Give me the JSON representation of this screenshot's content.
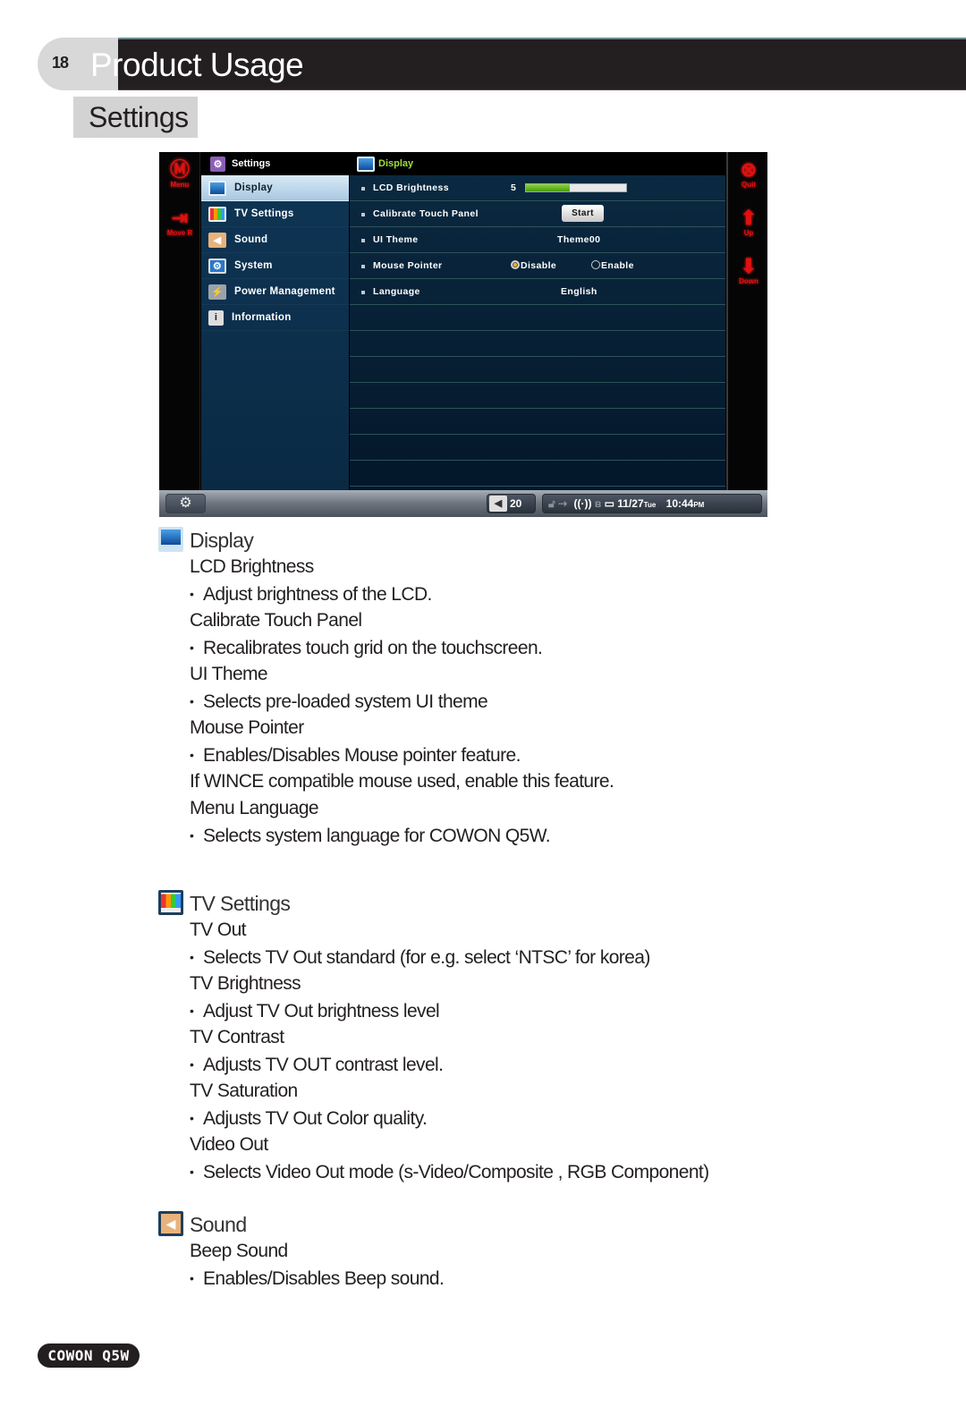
{
  "header": {
    "page_number": "18",
    "title": "Product Usage",
    "section": "Settings"
  },
  "device": {
    "left_buttons": [
      {
        "icon": "menu-circle-m-icon",
        "glyph": "Ⓜ",
        "label": "Menu"
      },
      {
        "icon": "move-right-icon",
        "glyph": "⇥",
        "label": "Move R"
      }
    ],
    "right_buttons": [
      {
        "icon": "quit-circle-x-icon",
        "glyph": "⊗",
        "label": "Quit"
      },
      {
        "icon": "arrow-up-icon",
        "glyph": "⬆",
        "label": "Up"
      },
      {
        "icon": "arrow-down-icon",
        "glyph": "⬇",
        "label": "Down"
      }
    ],
    "menu": {
      "title": "Settings",
      "items": [
        {
          "label": "Display",
          "icon": "display-monitor-icon",
          "active": true
        },
        {
          "label": "TV Settings",
          "icon": "tv-color-bars-icon"
        },
        {
          "label": "Sound",
          "icon": "speaker-icon"
        },
        {
          "label": "System",
          "icon": "system-gear-icon"
        },
        {
          "label": "Power Management",
          "icon": "power-lightning-icon"
        },
        {
          "label": "Information",
          "icon": "info-icon"
        }
      ]
    },
    "panel": {
      "title": "Display",
      "rows": [
        {
          "label": "LCD Brightness",
          "value": "5",
          "bar_fraction": 0.44
        },
        {
          "label": "Calibrate Touch Panel",
          "button": "Start"
        },
        {
          "label": "UI Theme",
          "value": "Theme00"
        },
        {
          "label": "Mouse Pointer",
          "options": [
            "Disable",
            "Enable"
          ],
          "selected": "Disable"
        },
        {
          "label": "Language",
          "value": "English"
        }
      ]
    },
    "status": {
      "volume": "20",
      "date": "11/27",
      "weekday": "Tue",
      "time": "10:44",
      "ampm": "PM"
    }
  },
  "sections": [
    {
      "title": "Display",
      "lines": [
        {
          "type": "sub",
          "text": "LCD Brightness"
        },
        {
          "type": "bullet",
          "text": "Adjust brightness of the LCD."
        },
        {
          "type": "sub",
          "text": "Calibrate Touch Panel"
        },
        {
          "type": "bullet",
          "text": "Recalibrates touch grid on the touchscreen."
        },
        {
          "type": "sub",
          "text": "UI Theme"
        },
        {
          "type": "bullet",
          "text": "Selects pre-loaded system UI theme"
        },
        {
          "type": "sub",
          "text": "Mouse Pointer"
        },
        {
          "type": "bullet",
          "text": "Enables/Disables Mouse pointer feature."
        },
        {
          "type": "sub",
          "text": "If WINCE compatible mouse used, enable this feature."
        },
        {
          "type": "sub",
          "text": "Menu Language"
        },
        {
          "type": "bullet",
          "text": "Selects system language for COWON Q5W."
        }
      ]
    },
    {
      "title": "TV Settings",
      "lines": [
        {
          "type": "sub",
          "text": "TV Out"
        },
        {
          "type": "bullet",
          "text": "Selects TV Out standard (for e.g. select ‘NTSC’ for korea)"
        },
        {
          "type": "sub",
          "text": "TV Brightness"
        },
        {
          "type": "bullet",
          "text": "Adjust TV Out brightness level"
        },
        {
          "type": "sub",
          "text": "TV Contrast"
        },
        {
          "type": "bullet",
          "text": "Adjusts TV OUT contrast level."
        },
        {
          "type": "sub",
          "text": "TV Saturation"
        },
        {
          "type": "bullet",
          "text": "Adjusts TV Out Color quality."
        },
        {
          "type": "sub",
          "text": "Video Out"
        },
        {
          "type": "bullet",
          "text": "Selects Video Out mode (s-Video/Composite , RGB Component)"
        }
      ]
    },
    {
      "title": "Sound",
      "lines": [
        {
          "type": "sub",
          "text": "Beep Sound"
        },
        {
          "type": "bullet",
          "text": "Enables/Disables Beep sound."
        }
      ]
    }
  ],
  "footer": {
    "brand": "COWON Q5W"
  }
}
